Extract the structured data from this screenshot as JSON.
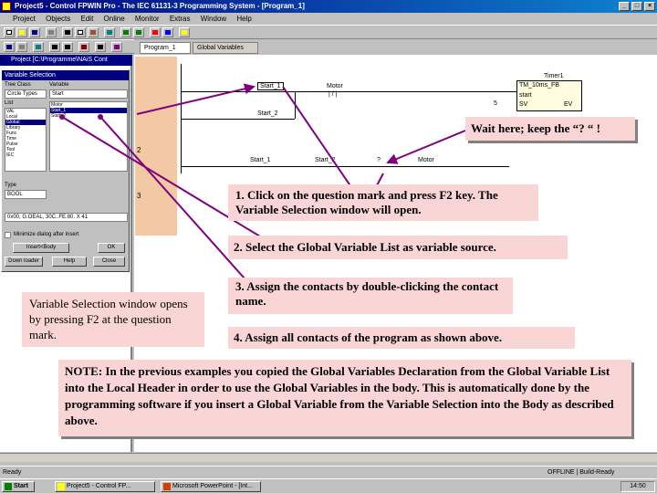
{
  "window": {
    "title": "Project5 - Control FPWIN Pro - The IEC 61131-3 Programming System - [Program_1]"
  },
  "menu": {
    "items": [
      "Project",
      "Objects",
      "Edit",
      "Online",
      "Monitor",
      "Extras",
      "Window",
      "Help"
    ]
  },
  "left_pane": {
    "title": "Project [C:\\Programme\\NAiS Cont"
  },
  "dialog": {
    "title": "Variable Selection",
    "tree_class_label": "Tree Class",
    "tree_class_value": "Circle Types",
    "variable_label": "Variable",
    "variable_value": "Start",
    "list_label": "List",
    "list_items": [
      "VAL",
      "Local",
      "Global",
      "Library",
      "Func",
      "Time",
      "Pulse",
      "Tool",
      "IEC"
    ],
    "variable_items": [
      "Motor",
      "Start_1",
      "Start_2"
    ],
    "type_label": "Type",
    "type_value": "BOOL",
    "path_value": "0x00, G.OEAL, 30C..FE.80.  X 41",
    "checkbox_label": "Minimize dialog after insert",
    "btn_insert": "Insert<Body",
    "btn_ok": "OK",
    "btn_downloader": "Down loader",
    "btn_help": "Help",
    "btn_close": "Close"
  },
  "editor": {
    "tabs": [
      "Program_1",
      "Global Variables"
    ],
    "networks": [
      "2",
      "3"
    ],
    "contacts": {
      "start1_top": "Start_1",
      "motor_top": "Motor",
      "start2": "Start_2",
      "start1_net2": "Start_1",
      "start2_net2": "Start_2",
      "question": "?",
      "motor_net2": "Motor"
    },
    "timer": {
      "label": "Timer1",
      "fb": "TM_10ms_FB",
      "start": "start",
      "sv": "SV",
      "ev": "EV",
      "preset": "5"
    }
  },
  "notes": {
    "wait": "Wait here; keep the “? “ !",
    "step1": "1. Click on the question mark and press F2 key. The Variable Selection window will open.",
    "step2": "2. Select the Global Variable List as variable source.",
    "step3": "3. Assign the contacts by double-clicking the contact name.",
    "step4": "4. Assign all contacts of the program as shown above.",
    "left": "Variable Selection window opens by pressing F2 at the question mark.",
    "bottom": "NOTE: In the previous examples you copied the Global Variables Declaration from the Global Variable List into the Local Header in order to use the Global Variables in the body. This is automatically done by the programming software if you insert a Global Variable from the Variable Selection into the Body as described above."
  },
  "status": {
    "left": "Ready",
    "right": "OFFLINE   |  Build-Ready"
  },
  "taskbar": {
    "start": "Start",
    "item1": "Project5 - Control FP...",
    "item2": "Microsoft PowerPoint - [Int...",
    "clock": "14:50"
  }
}
